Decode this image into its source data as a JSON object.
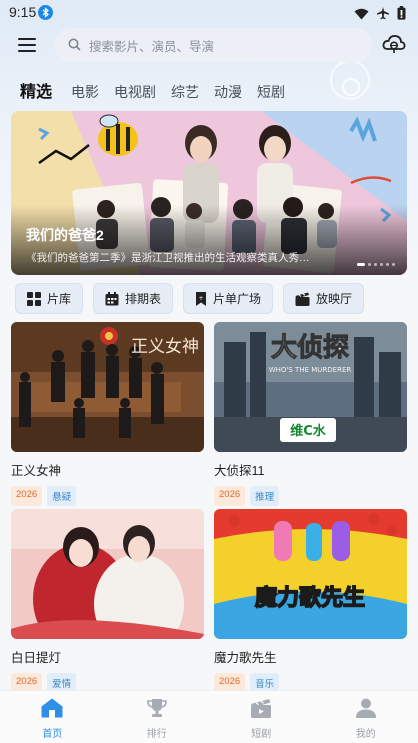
{
  "status": {
    "time": "9:15"
  },
  "header": {
    "search_placeholder": "搜索影片、演员、导演"
  },
  "tabs": [
    {
      "label": "精选",
      "active": true
    },
    {
      "label": "电影",
      "active": false
    },
    {
      "label": "电视剧",
      "active": false
    },
    {
      "label": "综艺",
      "active": false
    },
    {
      "label": "动漫",
      "active": false
    },
    {
      "label": "短剧",
      "active": false
    }
  ],
  "banner": {
    "title": "我们的爸爸2",
    "description": "《我们的爸爸第二季》是浙江卫视推出的生活观察类真人秀…",
    "slide_count": 6,
    "active_slide": 0
  },
  "quick_links": [
    {
      "label": "片库",
      "icon": "grid-icon"
    },
    {
      "label": "排期表",
      "icon": "calendar-icon"
    },
    {
      "label": "片单广场",
      "icon": "bookmark-icon"
    },
    {
      "label": "放映厅",
      "icon": "clapperboard-icon"
    }
  ],
  "cards": [
    {
      "title": "正义女神",
      "year": "2026",
      "genre": "悬疑",
      "poster_text": "正义女神"
    },
    {
      "title": "大侦探11",
      "year": "2026",
      "genre": "推理",
      "poster_text": "大侦探",
      "poster_sub": "WHO'S THE MURDERER",
      "sponsor": "维C水"
    },
    {
      "title": "白日提灯",
      "year": "2026",
      "genre": "爱情"
    },
    {
      "title": "魔力歌先生",
      "year": "2026",
      "genre": "音乐",
      "poster_text": "魔力歌先生"
    }
  ],
  "bottom_nav": [
    {
      "label": "首页",
      "icon": "home-icon",
      "active": true
    },
    {
      "label": "排行",
      "icon": "trophy-icon",
      "active": false
    },
    {
      "label": "短剧",
      "icon": "clapperboard-icon",
      "active": false
    },
    {
      "label": "我的",
      "icon": "user-icon",
      "active": false
    }
  ],
  "colors": {
    "accent": "#2f8fe6",
    "year_tag": "#e06b2b",
    "genre_tag": "#3a86c8"
  }
}
